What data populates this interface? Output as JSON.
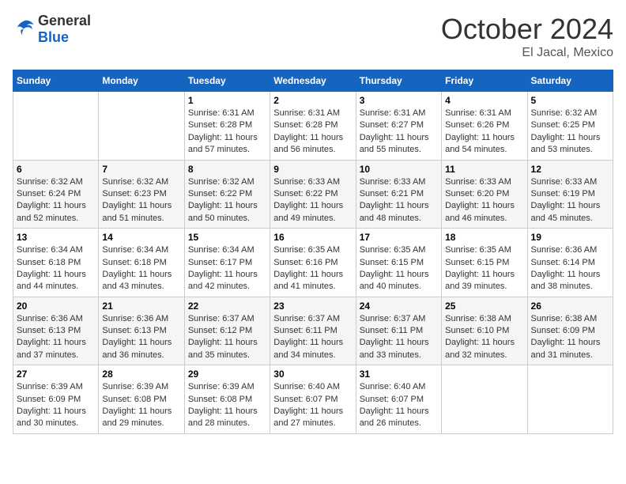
{
  "header": {
    "logo": {
      "general": "General",
      "blue": "Blue"
    },
    "month": "October 2024",
    "location": "El Jacal, Mexico"
  },
  "weekdays": [
    "Sunday",
    "Monday",
    "Tuesday",
    "Wednesday",
    "Thursday",
    "Friday",
    "Saturday"
  ],
  "weeks": [
    [
      null,
      null,
      {
        "day": 1,
        "sunrise": "6:31 AM",
        "sunset": "6:28 PM",
        "daylight": "11 hours and 57 minutes."
      },
      {
        "day": 2,
        "sunrise": "6:31 AM",
        "sunset": "6:28 PM",
        "daylight": "11 hours and 56 minutes."
      },
      {
        "day": 3,
        "sunrise": "6:31 AM",
        "sunset": "6:27 PM",
        "daylight": "11 hours and 55 minutes."
      },
      {
        "day": 4,
        "sunrise": "6:31 AM",
        "sunset": "6:26 PM",
        "daylight": "11 hours and 54 minutes."
      },
      {
        "day": 5,
        "sunrise": "6:32 AM",
        "sunset": "6:25 PM",
        "daylight": "11 hours and 53 minutes."
      }
    ],
    [
      {
        "day": 6,
        "sunrise": "6:32 AM",
        "sunset": "6:24 PM",
        "daylight": "11 hours and 52 minutes."
      },
      {
        "day": 7,
        "sunrise": "6:32 AM",
        "sunset": "6:23 PM",
        "daylight": "11 hours and 51 minutes."
      },
      {
        "day": 8,
        "sunrise": "6:32 AM",
        "sunset": "6:22 PM",
        "daylight": "11 hours and 50 minutes."
      },
      {
        "day": 9,
        "sunrise": "6:33 AM",
        "sunset": "6:22 PM",
        "daylight": "11 hours and 49 minutes."
      },
      {
        "day": 10,
        "sunrise": "6:33 AM",
        "sunset": "6:21 PM",
        "daylight": "11 hours and 48 minutes."
      },
      {
        "day": 11,
        "sunrise": "6:33 AM",
        "sunset": "6:20 PM",
        "daylight": "11 hours and 46 minutes."
      },
      {
        "day": 12,
        "sunrise": "6:33 AM",
        "sunset": "6:19 PM",
        "daylight": "11 hours and 45 minutes."
      }
    ],
    [
      {
        "day": 13,
        "sunrise": "6:34 AM",
        "sunset": "6:18 PM",
        "daylight": "11 hours and 44 minutes."
      },
      {
        "day": 14,
        "sunrise": "6:34 AM",
        "sunset": "6:18 PM",
        "daylight": "11 hours and 43 minutes."
      },
      {
        "day": 15,
        "sunrise": "6:34 AM",
        "sunset": "6:17 PM",
        "daylight": "11 hours and 42 minutes."
      },
      {
        "day": 16,
        "sunrise": "6:35 AM",
        "sunset": "6:16 PM",
        "daylight": "11 hours and 41 minutes."
      },
      {
        "day": 17,
        "sunrise": "6:35 AM",
        "sunset": "6:15 PM",
        "daylight": "11 hours and 40 minutes."
      },
      {
        "day": 18,
        "sunrise": "6:35 AM",
        "sunset": "6:15 PM",
        "daylight": "11 hours and 39 minutes."
      },
      {
        "day": 19,
        "sunrise": "6:36 AM",
        "sunset": "6:14 PM",
        "daylight": "11 hours and 38 minutes."
      }
    ],
    [
      {
        "day": 20,
        "sunrise": "6:36 AM",
        "sunset": "6:13 PM",
        "daylight": "11 hours and 37 minutes."
      },
      {
        "day": 21,
        "sunrise": "6:36 AM",
        "sunset": "6:13 PM",
        "daylight": "11 hours and 36 minutes."
      },
      {
        "day": 22,
        "sunrise": "6:37 AM",
        "sunset": "6:12 PM",
        "daylight": "11 hours and 35 minutes."
      },
      {
        "day": 23,
        "sunrise": "6:37 AM",
        "sunset": "6:11 PM",
        "daylight": "11 hours and 34 minutes."
      },
      {
        "day": 24,
        "sunrise": "6:37 AM",
        "sunset": "6:11 PM",
        "daylight": "11 hours and 33 minutes."
      },
      {
        "day": 25,
        "sunrise": "6:38 AM",
        "sunset": "6:10 PM",
        "daylight": "11 hours and 32 minutes."
      },
      {
        "day": 26,
        "sunrise": "6:38 AM",
        "sunset": "6:09 PM",
        "daylight": "11 hours and 31 minutes."
      }
    ],
    [
      {
        "day": 27,
        "sunrise": "6:39 AM",
        "sunset": "6:09 PM",
        "daylight": "11 hours and 30 minutes."
      },
      {
        "day": 28,
        "sunrise": "6:39 AM",
        "sunset": "6:08 PM",
        "daylight": "11 hours and 29 minutes."
      },
      {
        "day": 29,
        "sunrise": "6:39 AM",
        "sunset": "6:08 PM",
        "daylight": "11 hours and 28 minutes."
      },
      {
        "day": 30,
        "sunrise": "6:40 AM",
        "sunset": "6:07 PM",
        "daylight": "11 hours and 27 minutes."
      },
      {
        "day": 31,
        "sunrise": "6:40 AM",
        "sunset": "6:07 PM",
        "daylight": "11 hours and 26 minutes."
      },
      null,
      null
    ]
  ]
}
